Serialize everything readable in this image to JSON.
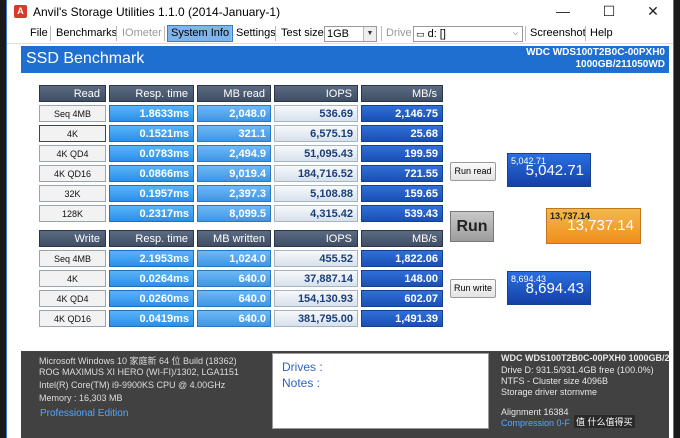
{
  "window": {
    "title": "Anvil's Storage Utilities 1.1.0 (2014-January-1)",
    "app_icon": "A",
    "controls": {
      "minimize": "—",
      "maximize": "☐",
      "close": "✕"
    }
  },
  "menu": {
    "file": "File",
    "benchmarks": "Benchmarks",
    "iometer": "IOmeter",
    "system_info": "System Info",
    "settings": "Settings",
    "test_size_label": "Test size",
    "test_size_value": "1GB",
    "drive_label": "Drive",
    "drive_value": "d: []",
    "screenshot": "Screenshot",
    "help": "Help"
  },
  "header": {
    "title": "SSD Benchmark",
    "drive_model": "WDC WDS100T2B0C-00PXH0",
    "drive_info": "1000GB/211050WD"
  },
  "read": {
    "headers": [
      "Read",
      "Resp. time",
      "MB read",
      "IOPS",
      "MB/s"
    ],
    "rows": [
      {
        "label": "Seq 4MB",
        "time": "1.8633ms",
        "mb": "2,048.0",
        "iops": "536.69",
        "mbs": "2,146.75"
      },
      {
        "label": "4K",
        "time": "0.1521ms",
        "mb": "321.1",
        "iops": "6,575.19",
        "mbs": "25.68"
      },
      {
        "label": "4K QD4",
        "time": "0.0783ms",
        "mb": "2,494.9",
        "iops": "51,095.43",
        "mbs": "199.59"
      },
      {
        "label": "4K QD16",
        "time": "0.0866ms",
        "mb": "9,019.4",
        "iops": "184,716.52",
        "mbs": "721.55"
      },
      {
        "label": "32K",
        "time": "0.1957ms",
        "mb": "2,397.3",
        "iops": "5,108.88",
        "mbs": "159.65"
      },
      {
        "label": "128K",
        "time": "0.2317ms",
        "mb": "8,099.5",
        "iops": "4,315.42",
        "mbs": "539.43"
      }
    ],
    "button": "Run read",
    "score_small": "5,042.71",
    "score_big": "5,042.71"
  },
  "write": {
    "headers": [
      "Write",
      "Resp. time",
      "MB written",
      "IOPS",
      "MB/s"
    ],
    "rows": [
      {
        "label": "Seq 4MB",
        "time": "2.1953ms",
        "mb": "1,024.0",
        "iops": "455.52",
        "mbs": "1,822.06"
      },
      {
        "label": "4K",
        "time": "0.0264ms",
        "mb": "640.0",
        "iops": "37,887.14",
        "mbs": "148.00"
      },
      {
        "label": "4K QD4",
        "time": "0.0260ms",
        "mb": "640.0",
        "iops": "154,130.93",
        "mbs": "602.07"
      },
      {
        "label": "4K QD16",
        "time": "0.0419ms",
        "mb": "640.0",
        "iops": "381,795.00",
        "mbs": "1,491.39"
      }
    ],
    "button": "Run write",
    "score_small": "8,694.43",
    "score_big": "8,694.43"
  },
  "run_label": "Run",
  "total": {
    "small": "13,737.14",
    "big": "13,737.14"
  },
  "system": {
    "os": "Microsoft Windows 10 家庭新 64 位 Build (18362)",
    "board": "ROG MAXIMUS XI HERO (WI-FI)/1302, LGA1151",
    "cpu": "Intel(R) Core(TM) i9-9900KS CPU @ 4.00GHz",
    "memory": "Memory : 16,303 MB",
    "edition": "Professional Edition"
  },
  "notes": {
    "drives": "Drives :",
    "notes": "Notes :"
  },
  "drive_details": {
    "title": "WDC WDS100T2B0C-00PXH0 1000GB/2",
    "capacity": "Drive D: 931.5/931.4GB free (100.0%)",
    "fs": "NTFS - Cluster size 4096B",
    "driver": "Storage driver  stornvme",
    "alignment": "Alignment 16384",
    "compression": "Compression 0-F"
  },
  "watermark": "值 什么值得买"
}
